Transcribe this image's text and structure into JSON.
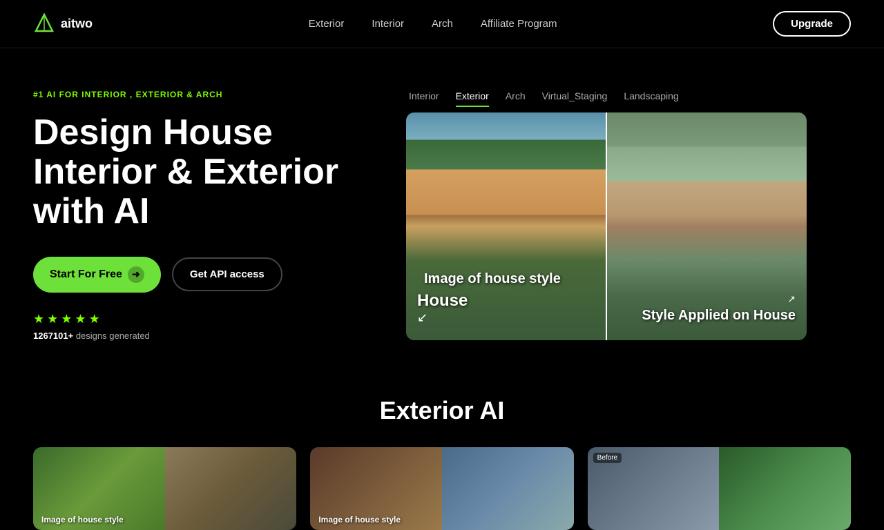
{
  "brand": {
    "name": "aitwo",
    "logoAlt": "Aitwo Logo"
  },
  "navbar": {
    "links": [
      {
        "id": "exterior",
        "label": "Exterior"
      },
      {
        "id": "interior",
        "label": "Interior"
      },
      {
        "id": "arch",
        "label": "Arch"
      },
      {
        "id": "affiliate",
        "label": "Affiliate Program"
      }
    ],
    "upgrade_label": "Upgrade"
  },
  "hero": {
    "tag": "#1 AI FOR INTERIOR , EXTERIOR & ARCH",
    "title": "Design House Interior & Exterior with AI",
    "btn_start": "Start For Free",
    "btn_api": "Get API access",
    "stars": 5,
    "count": "1267101+",
    "count_suffix": " designs generated"
  },
  "preview": {
    "tabs": [
      {
        "id": "interior",
        "label": "Interior"
      },
      {
        "id": "exterior",
        "label": "Exterior",
        "active": true
      },
      {
        "id": "arch",
        "label": "Arch"
      },
      {
        "id": "virtual_staging",
        "label": "Virtual_Staging"
      },
      {
        "id": "landscaping",
        "label": "Landscaping"
      }
    ],
    "left_label_top": "Image of house style",
    "left_label_bottom": "House",
    "right_label": "Style Applied on House"
  },
  "section": {
    "exterior_ai_title": "Exterior AI"
  },
  "cards": [
    {
      "id": "card1",
      "overlay_text": "Image of house style"
    },
    {
      "id": "card2",
      "overlay_text": "Image of house style"
    },
    {
      "id": "card3",
      "before_label": "Before"
    }
  ]
}
